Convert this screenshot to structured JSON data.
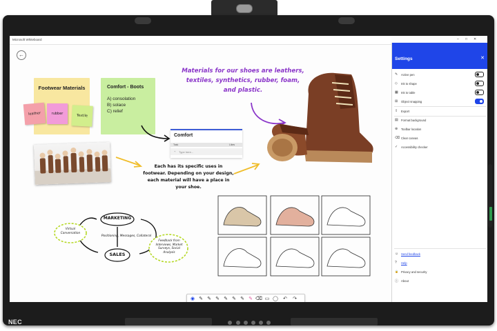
{
  "window": {
    "title": "Microsoft Whiteboard",
    "controls": [
      "–",
      "□",
      "✕"
    ]
  },
  "device": {
    "brand": "NEC"
  },
  "board": {
    "footwear_note": {
      "title": "Footwear Materials",
      "color": "#f8e7a0"
    },
    "small_stickies": [
      {
        "label": "leather",
        "color": "#f4a0aa"
      },
      {
        "label": "rubber",
        "color": "#f29bd9"
      },
      {
        "label": "Textile",
        "color": "#d2ee8c"
      }
    ],
    "comfort_note": {
      "title": "Comfort - Boots",
      "lines": [
        "A) consolation",
        "B) solace",
        "C) relief"
      ],
      "color": "#c9eea0"
    },
    "comfort_table": {
      "title": "Comfort",
      "col1": "Task",
      "col2": "Likes",
      "placeholder": "Type here..."
    },
    "materials_text": "Materials for our shoes are leathers, textiles, synthetics, rubber, foam, and plastic.",
    "uses_text": "Each has its specific uses in footwear. Depending on your design, each material will have a place in your shoe.",
    "mindmap": {
      "marketing": "MARKETING",
      "sales": "SALES",
      "virtual": "Virtual Conversation",
      "positioning": "Positioning, Messages, Collateral",
      "feedback": "Feedback from Interviews, Market Surveys, Social Analysis"
    }
  },
  "settings": {
    "title": "Settings",
    "items": [
      {
        "icon": "✎",
        "label": "Active pen",
        "toggle": "off"
      },
      {
        "icon": "◇",
        "label": "Ink to shape",
        "toggle": "off"
      },
      {
        "icon": "▦",
        "label": "Ink to table",
        "toggle": "off"
      },
      {
        "icon": "⊞",
        "label": "Object snapping",
        "toggle": "on"
      },
      {
        "icon": "⇪",
        "label": "Export"
      },
      {
        "icon": "▤",
        "label": "Format background"
      },
      {
        "icon": "⊕",
        "label": "Toolbar location"
      },
      {
        "icon": "⌫",
        "label": "Clear canvas"
      },
      {
        "icon": "✓",
        "label": "Accessibility checker"
      }
    ],
    "footer": [
      {
        "icon": "☺",
        "label": "Send feedback",
        "link": true
      },
      {
        "icon": "?",
        "label": "Help",
        "link": true
      },
      {
        "icon": "🔒",
        "label": "Privacy and security"
      },
      {
        "icon": "ⓘ",
        "label": "About"
      }
    ],
    "accent": "#1f45e8"
  },
  "toolbar": {
    "tools": [
      "◉",
      "✎",
      "✎",
      "✎",
      "✎",
      "✎",
      "✎",
      "✎",
      "⌫",
      "▭",
      "◯",
      "↶",
      "↷"
    ]
  }
}
